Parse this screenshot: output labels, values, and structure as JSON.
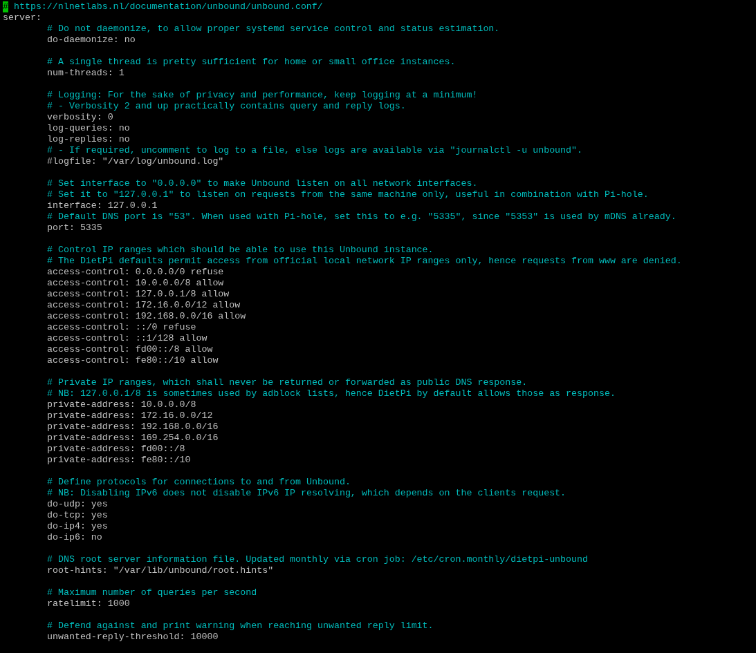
{
  "lines": [
    {
      "kind": "comment",
      "text": "# https://nlnetlabs.nl/documentation/unbound/unbound.conf/",
      "cursor": true
    },
    {
      "kind": "plain",
      "text": "server:",
      "children": [
        {
          "kind": "comment",
          "text": "# Do not daemonize, to allow proper systemd service control and status estimation."
        },
        {
          "kind": "plain",
          "text": "do-daemonize: no"
        },
        {
          "kind": "blank"
        },
        {
          "kind": "comment",
          "text": "# A single thread is pretty sufficient for home or small office instances."
        },
        {
          "kind": "plain",
          "text": "num-threads: 1"
        },
        {
          "kind": "blank"
        },
        {
          "kind": "comment",
          "text": "# Logging: For the sake of privacy and performance, keep logging at a minimum!"
        },
        {
          "kind": "comment",
          "text": "# - Verbosity 2 and up practically contains query and reply logs."
        },
        {
          "kind": "plain",
          "text": "verbosity: 0"
        },
        {
          "kind": "plain",
          "text": "log-queries: no"
        },
        {
          "kind": "plain",
          "text": "log-replies: no"
        },
        {
          "kind": "comment",
          "text": "# - If required, uncomment to log to a file, else logs are available via \"journalctl -u unbound\"."
        },
        {
          "kind": "plain",
          "text": "#logfile: \"/var/log/unbound.log\""
        },
        {
          "kind": "blank"
        },
        {
          "kind": "comment",
          "text": "# Set interface to \"0.0.0.0\" to make Unbound listen on all network interfaces."
        },
        {
          "kind": "comment",
          "text": "# Set it to \"127.0.0.1\" to listen on requests from the same machine only, useful in combination with Pi-hole."
        },
        {
          "kind": "plain",
          "text": "interface: 127.0.0.1"
        },
        {
          "kind": "comment",
          "text": "# Default DNS port is \"53\". When used with Pi-hole, set this to e.g. \"5335\", since \"5353\" is used by mDNS already."
        },
        {
          "kind": "plain",
          "text": "port: 5335"
        },
        {
          "kind": "blank"
        },
        {
          "kind": "comment",
          "text": "# Control IP ranges which should be able to use this Unbound instance."
        },
        {
          "kind": "comment",
          "text": "# The DietPi defaults permit access from official local network IP ranges only, hence requests from www are denied."
        },
        {
          "kind": "plain",
          "text": "access-control: 0.0.0.0/0 refuse"
        },
        {
          "kind": "plain",
          "text": "access-control: 10.0.0.0/8 allow"
        },
        {
          "kind": "plain",
          "text": "access-control: 127.0.0.1/8 allow"
        },
        {
          "kind": "plain",
          "text": "access-control: 172.16.0.0/12 allow"
        },
        {
          "kind": "plain",
          "text": "access-control: 192.168.0.0/16 allow"
        },
        {
          "kind": "plain",
          "text": "access-control: ::/0 refuse"
        },
        {
          "kind": "plain",
          "text": "access-control: ::1/128 allow"
        },
        {
          "kind": "plain",
          "text": "access-control: fd00::/8 allow"
        },
        {
          "kind": "plain",
          "text": "access-control: fe80::/10 allow"
        },
        {
          "kind": "blank"
        },
        {
          "kind": "comment",
          "text": "# Private IP ranges, which shall never be returned or forwarded as public DNS response."
        },
        {
          "kind": "comment",
          "text": "# NB: 127.0.0.1/8 is sometimes used by adblock lists, hence DietPi by default allows those as response."
        },
        {
          "kind": "plain",
          "text": "private-address: 10.0.0.0/8"
        },
        {
          "kind": "plain",
          "text": "private-address: 172.16.0.0/12"
        },
        {
          "kind": "plain",
          "text": "private-address: 192.168.0.0/16"
        },
        {
          "kind": "plain",
          "text": "private-address: 169.254.0.0/16"
        },
        {
          "kind": "plain",
          "text": "private-address: fd00::/8"
        },
        {
          "kind": "plain",
          "text": "private-address: fe80::/10"
        },
        {
          "kind": "blank"
        },
        {
          "kind": "comment",
          "text": "# Define protocols for connections to and from Unbound."
        },
        {
          "kind": "comment",
          "text": "# NB: Disabling IPv6 does not disable IPv6 IP resolving, which depends on the clients request."
        },
        {
          "kind": "plain",
          "text": "do-udp: yes"
        },
        {
          "kind": "plain",
          "text": "do-tcp: yes"
        },
        {
          "kind": "plain",
          "text": "do-ip4: yes"
        },
        {
          "kind": "plain",
          "text": "do-ip6: no"
        },
        {
          "kind": "blank"
        },
        {
          "kind": "comment",
          "text": "# DNS root server information file. Updated monthly via cron job: /etc/cron.monthly/dietpi-unbound"
        },
        {
          "kind": "plain",
          "text": "root-hints: \"/var/lib/unbound/root.hints\""
        },
        {
          "kind": "blank"
        },
        {
          "kind": "comment",
          "text": "# Maximum number of queries per second"
        },
        {
          "kind": "plain",
          "text": "ratelimit: 1000"
        },
        {
          "kind": "blank"
        },
        {
          "kind": "comment",
          "text": "# Defend against and print warning when reaching unwanted reply limit."
        },
        {
          "kind": "plain",
          "text": "unwanted-reply-threshold: 10000"
        }
      ]
    }
  ]
}
